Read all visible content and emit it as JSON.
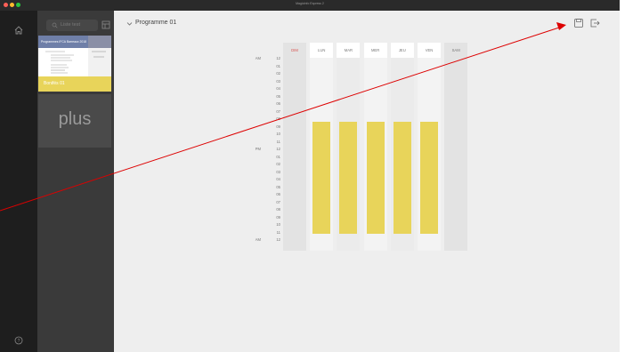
{
  "window": {
    "title": "MagicInfo Express 2"
  },
  "colors": {
    "accent_yellow": "#e8d45a",
    "sunday_red": "#d9534f",
    "arrow_red": "#dd0000"
  },
  "left_rail": {
    "home_icon": "home-icon",
    "help_icon": "help-icon"
  },
  "sidebar": {
    "search_placeholder": "Liste test",
    "layout_icon": "layout-icon",
    "program_card": {
      "label": "Bonifés 01",
      "thumbnail_title": "Programmes IFCA Barreaux 2018"
    },
    "add_icon": "plus"
  },
  "main": {
    "program_title": "Programme 01",
    "chevron_icon": "chevron-down-icon",
    "save_icon": "save-icon",
    "exit_icon": "exit-icon",
    "days": [
      "DIM",
      "LUN",
      "MAR",
      "MER",
      "JEU",
      "VEN",
      "SAM"
    ],
    "hours": [
      {
        "prefix": "AM",
        "label": "12"
      },
      {
        "prefix": "",
        "label": "01"
      },
      {
        "prefix": "",
        "label": "02"
      },
      {
        "prefix": "",
        "label": "03"
      },
      {
        "prefix": "",
        "label": "04"
      },
      {
        "prefix": "",
        "label": "05"
      },
      {
        "prefix": "",
        "label": "06"
      },
      {
        "prefix": "",
        "label": "07"
      },
      {
        "prefix": "",
        "label": "08"
      },
      {
        "prefix": "",
        "label": "09"
      },
      {
        "prefix": "",
        "label": "10"
      },
      {
        "prefix": "",
        "label": "11"
      },
      {
        "prefix": "PM",
        "label": "12"
      },
      {
        "prefix": "",
        "label": "01"
      },
      {
        "prefix": "",
        "label": "02"
      },
      {
        "prefix": "",
        "label": "03"
      },
      {
        "prefix": "",
        "label": "04"
      },
      {
        "prefix": "",
        "label": "05"
      },
      {
        "prefix": "",
        "label": "06"
      },
      {
        "prefix": "",
        "label": "07"
      },
      {
        "prefix": "",
        "label": "08"
      },
      {
        "prefix": "",
        "label": "09"
      },
      {
        "prefix": "",
        "label": "10"
      },
      {
        "prefix": "",
        "label": "11"
      },
      {
        "prefix": "AM",
        "label": "12"
      }
    ],
    "scheduled_blocks": [
      {
        "day": "LUN",
        "start": "08",
        "end": "11"
      },
      {
        "day": "MAR",
        "start": "08",
        "end": "11"
      },
      {
        "day": "MER",
        "start": "08",
        "end": "11"
      },
      {
        "day": "JEU",
        "start": "08",
        "end": "11"
      },
      {
        "day": "VEN",
        "start": "08",
        "end": "11"
      }
    ]
  }
}
